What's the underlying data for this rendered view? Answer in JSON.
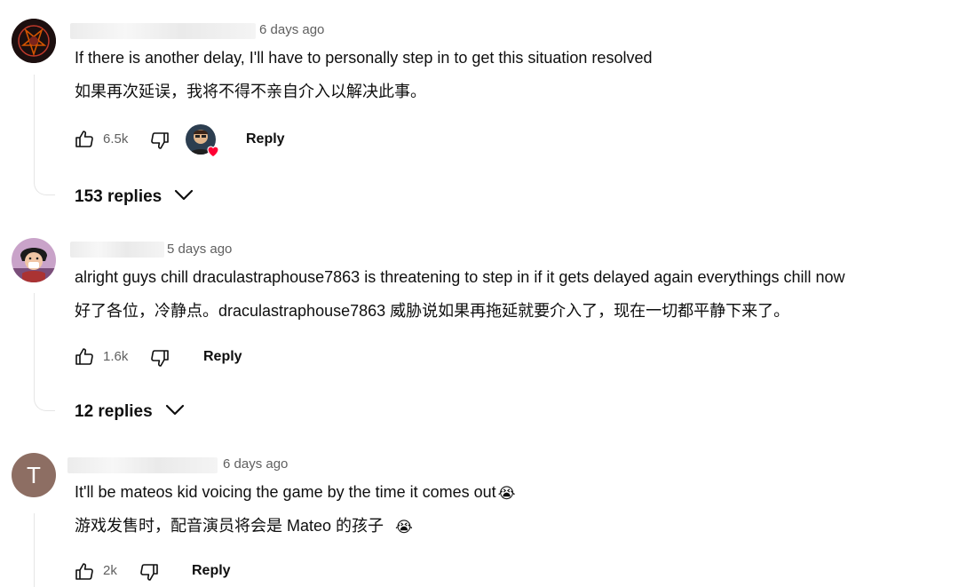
{
  "comments": [
    {
      "time": "6 days ago",
      "text": "If there is another delay, I'll have to personally step in to get this situation resolved",
      "translation": "如果再次延误，我将不得不亲自介入以解决此事。",
      "likes": "6.5k",
      "reply_label": "Reply",
      "replies_label": "153 replies",
      "avatar_icon": "pentagram-avatar-icon"
    },
    {
      "time": "5 days ago",
      "text": "alright guys chill draculastraphouse7863 is threatening to step in if it gets delayed again everythings chill now",
      "translation": "好了各位，冷静点。draculastraphouse7863 威胁说如果再拖延就要介入了，现在一切都平静下来了。",
      "likes": "1.6k",
      "reply_label": "Reply",
      "replies_label": "12 replies",
      "avatar_icon": "anime-character-avatar-icon"
    },
    {
      "time": "6 days ago",
      "text": "It'll be mateos kid voicing the game by the time it comes out",
      "translation": "游戏发售时，配音演员将会是 Mateo 的孩子",
      "emoji": "😭",
      "likes": "2k",
      "reply_label": "Reply",
      "avatar_letter": "T",
      "avatar_color": "#8d6e63"
    }
  ],
  "colors": {
    "text": "#0f0f0f",
    "muted": "#606060",
    "heart": "#ff0033"
  }
}
